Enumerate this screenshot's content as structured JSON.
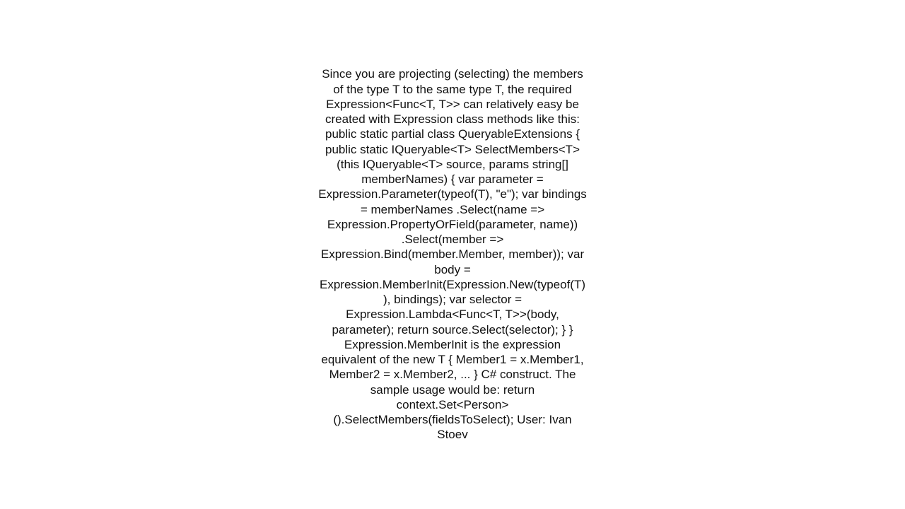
{
  "post": {
    "body": "Since you are projecting (selecting) the members of the type T to the same type T, the required Expression<Func<T, T>> can relatively easy be created with Expression class methods like this: public static partial class QueryableExtensions {     public static IQueryable<T> SelectMembers<T>(this IQueryable<T> source, params string[] memberNames)     {         var parameter = Expression.Parameter(typeof(T), \"e\");         var bindings = memberNames             .Select(name => Expression.PropertyOrField(parameter, name))             .Select(member => Expression.Bind(member.Member, member));         var body = Expression.MemberInit(Expression.New(typeof(T)), bindings);         var selector = Expression.Lambda<Func<T, T>>(body, parameter);         return source.Select(selector);     } }   Expression.MemberInit is the expression equivalent of the new T { Member1 = x.Member1, Member2 = x.Member2, ... } C# construct. The sample usage would be: return context.Set<Person>().SelectMembers(fieldsToSelect);   User: Ivan Stoev"
  }
}
